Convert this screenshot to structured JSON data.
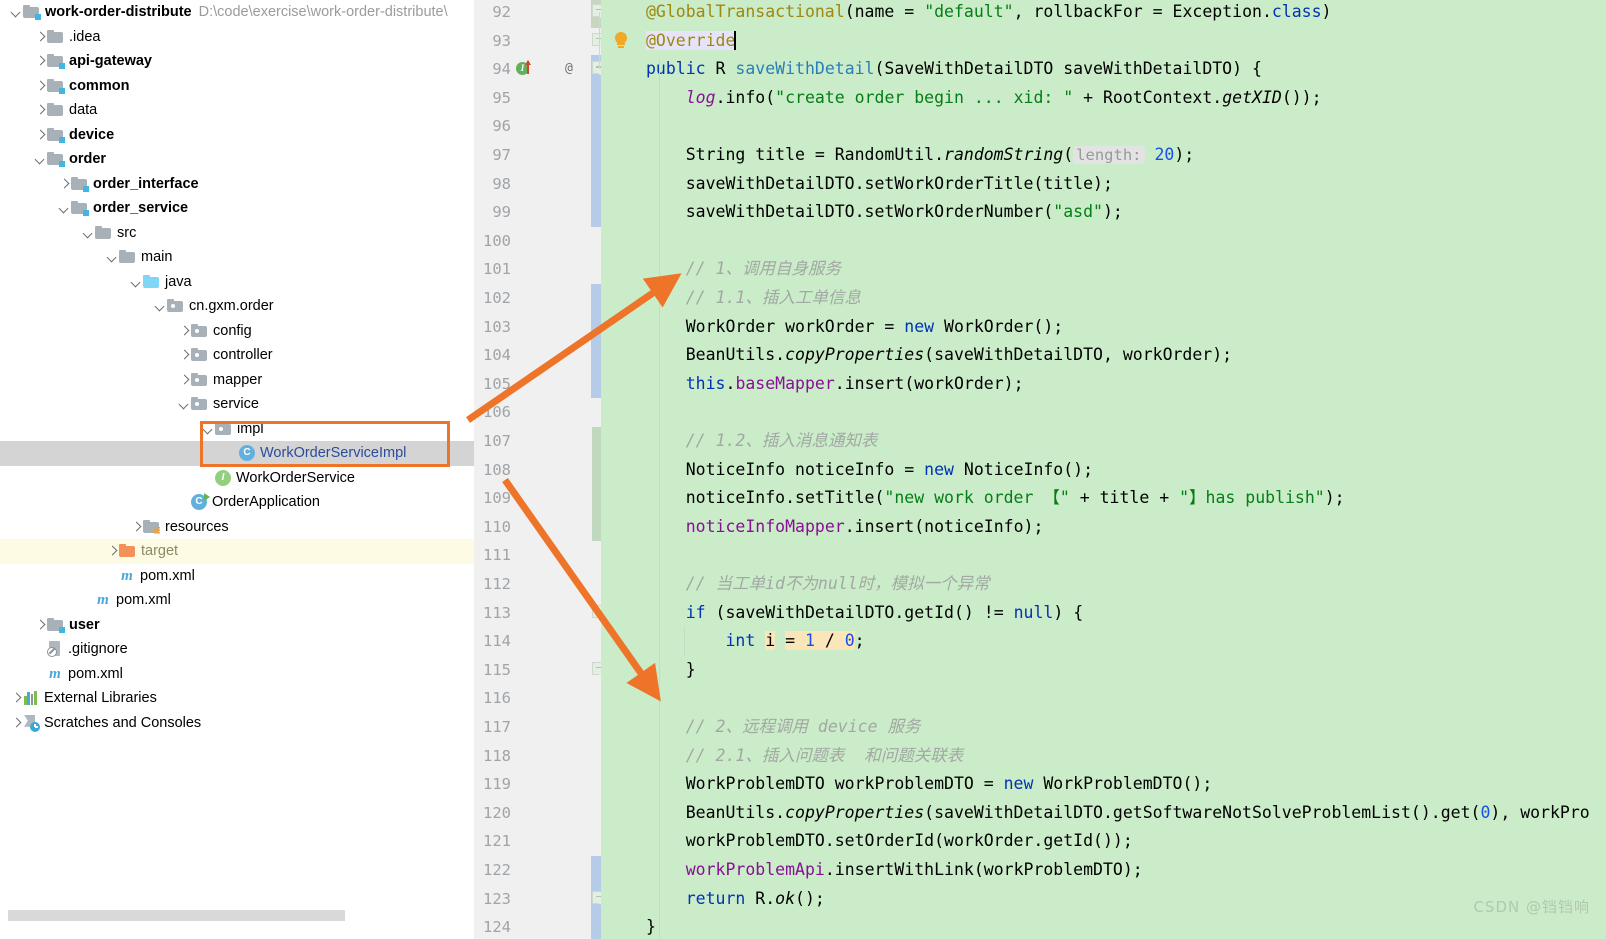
{
  "project": {
    "root": {
      "name": "work-order-distribute",
      "path": "D:\\code\\exercise\\work-order-distribute\\"
    },
    "items": [
      {
        "label": ".idea",
        "indent": 1,
        "arrow": "closed",
        "icon": "folder",
        "bold": false
      },
      {
        "label": "api-gateway",
        "indent": 1,
        "arrow": "closed",
        "icon": "module",
        "bold": true
      },
      {
        "label": "common",
        "indent": 1,
        "arrow": "closed",
        "icon": "module",
        "bold": true
      },
      {
        "label": "data",
        "indent": 1,
        "arrow": "closed",
        "icon": "folder",
        "bold": false
      },
      {
        "label": "device",
        "indent": 1,
        "arrow": "closed",
        "icon": "module",
        "bold": true
      },
      {
        "label": "order",
        "indent": 1,
        "arrow": "open",
        "icon": "module",
        "bold": true
      },
      {
        "label": "order_interface",
        "indent": 2,
        "arrow": "closed",
        "icon": "module",
        "bold": true
      },
      {
        "label": "order_service",
        "indent": 2,
        "arrow": "open",
        "icon": "module",
        "bold": true
      },
      {
        "label": "src",
        "indent": 3,
        "arrow": "open",
        "icon": "folder",
        "bold": false
      },
      {
        "label": "main",
        "indent": 4,
        "arrow": "open",
        "icon": "folder",
        "bold": false
      },
      {
        "label": "java",
        "indent": 5,
        "arrow": "open",
        "icon": "source",
        "bold": false
      },
      {
        "label": "cn.gxm.order",
        "indent": 6,
        "arrow": "open",
        "icon": "package",
        "bold": false
      },
      {
        "label": "config",
        "indent": 7,
        "arrow": "closed",
        "icon": "package",
        "bold": false
      },
      {
        "label": "controller",
        "indent": 7,
        "arrow": "closed",
        "icon": "package",
        "bold": false
      },
      {
        "label": "mapper",
        "indent": 7,
        "arrow": "closed",
        "icon": "package",
        "bold": false
      },
      {
        "label": "service",
        "indent": 7,
        "arrow": "open",
        "icon": "package",
        "bold": false
      },
      {
        "label": "impl",
        "indent": 8,
        "arrow": "open",
        "icon": "package",
        "bold": false
      },
      {
        "label": "WorkOrderServiceImpl",
        "indent": 9,
        "arrow": "none",
        "icon": "class",
        "bold": false,
        "selected": true
      },
      {
        "label": "WorkOrderService",
        "indent": 8,
        "arrow": "none",
        "icon": "interface",
        "bold": false
      },
      {
        "label": "OrderApplication",
        "indent": 7,
        "arrow": "none",
        "icon": "spring-app",
        "bold": false
      },
      {
        "label": "resources",
        "indent": 5,
        "arrow": "closed",
        "icon": "resources",
        "bold": false
      },
      {
        "label": "target",
        "indent": 4,
        "arrow": "closed",
        "icon": "excluded",
        "bold": false,
        "excluded": true
      },
      {
        "label": "pom.xml",
        "indent": 4,
        "arrow": "none",
        "icon": "maven",
        "bold": false
      },
      {
        "label": "pom.xml",
        "indent": 3,
        "arrow": "none",
        "icon": "maven",
        "bold": false
      },
      {
        "label": "user",
        "indent": 1,
        "arrow": "closed",
        "icon": "module",
        "bold": true
      },
      {
        "label": ".gitignore",
        "indent": 1,
        "arrow": "none",
        "icon": "gitignore",
        "bold": false
      },
      {
        "label": "pom.xml",
        "indent": 1,
        "arrow": "none",
        "icon": "maven",
        "bold": false
      },
      {
        "label": "External Libraries",
        "indent": 0,
        "arrow": "closed",
        "icon": "libraries",
        "bold": false
      },
      {
        "label": "Scratches and Consoles",
        "indent": 0,
        "arrow": "closed",
        "icon": "scratches",
        "bold": false
      }
    ]
  },
  "editor": {
    "first_line": 92,
    "caret_line": 93,
    "lines": [
      {
        "n": 92,
        "tokens": [
          {
            "t": "@GlobalTransactional",
            "c": "ann"
          },
          {
            "t": "(",
            "c": "plain"
          },
          {
            "t": "name",
            "c": "plain"
          },
          {
            "t": " = ",
            "c": "plain"
          },
          {
            "t": "\"default\"",
            "c": "str"
          },
          {
            "t": ", rollbackFor = Exception.",
            "c": "plain"
          },
          {
            "t": "class",
            "c": "kw"
          },
          {
            "t": ")",
            "c": "plain"
          }
        ]
      },
      {
        "n": 93,
        "tokens": [
          {
            "t": "@Override",
            "c": "ann sel"
          },
          {
            "t": "CARET",
            "c": "caret"
          }
        ]
      },
      {
        "n": 94,
        "tokens": [
          {
            "t": "public",
            "c": "kw"
          },
          {
            "t": " R ",
            "c": "plain"
          },
          {
            "t": "saveWithDetail",
            "c": "ident-blue"
          },
          {
            "t": "(SaveWithDetailDTO saveWithDetailDTO) {",
            "c": "plain"
          }
        ]
      },
      {
        "n": 95,
        "tokens": [
          {
            "t": "    ",
            "c": "plain"
          },
          {
            "t": "log",
            "c": "stat"
          },
          {
            "t": ".info(",
            "c": "plain"
          },
          {
            "t": "\"create order begin ... xid: \"",
            "c": "str"
          },
          {
            "t": " + RootContext.",
            "c": "plain"
          },
          {
            "t": "getXID",
            "c": "mthi"
          },
          {
            "t": "());",
            "c": "plain"
          }
        ]
      },
      {
        "n": 96,
        "tokens": []
      },
      {
        "n": 97,
        "tokens": [
          {
            "t": "    String title = RandomUtil.",
            "c": "plain"
          },
          {
            "t": "randomString",
            "c": "mthi"
          },
          {
            "t": "(",
            "c": "plain"
          },
          {
            "t": "HINT:length:",
            "c": "hint"
          },
          {
            "t": " ",
            "c": "plain"
          },
          {
            "t": "20",
            "c": "num"
          },
          {
            "t": ");",
            "c": "plain"
          }
        ]
      },
      {
        "n": 98,
        "tokens": [
          {
            "t": "    saveWithDetailDTO.setWorkOrderTitle(title);",
            "c": "plain"
          }
        ]
      },
      {
        "n": 99,
        "tokens": [
          {
            "t": "    saveWithDetailDTO.setWorkOrderNumber(",
            "c": "plain"
          },
          {
            "t": "\"asd\"",
            "c": "str"
          },
          {
            "t": ");",
            "c": "plain"
          }
        ]
      },
      {
        "n": 100,
        "tokens": []
      },
      {
        "n": 101,
        "tokens": [
          {
            "t": "    // 1、调用自身服务",
            "c": "cmt"
          }
        ]
      },
      {
        "n": 102,
        "tokens": [
          {
            "t": "    // 1.1、插入工单信息",
            "c": "cmt"
          }
        ]
      },
      {
        "n": 103,
        "tokens": [
          {
            "t": "    WorkOrder workOrder = ",
            "c": "plain"
          },
          {
            "t": "new",
            "c": "kw"
          },
          {
            "t": " WorkOrder();",
            "c": "plain"
          }
        ]
      },
      {
        "n": 104,
        "tokens": [
          {
            "t": "    BeanUtils.",
            "c": "plain"
          },
          {
            "t": "copyProperties",
            "c": "mthi"
          },
          {
            "t": "(saveWithDetailDTO, workOrder);",
            "c": "plain"
          }
        ]
      },
      {
        "n": 105,
        "tokens": [
          {
            "t": "    ",
            "c": "plain"
          },
          {
            "t": "this",
            "c": "kw"
          },
          {
            "t": ".",
            "c": "plain"
          },
          {
            "t": "baseMapper",
            "c": "fld"
          },
          {
            "t": ".insert(workOrder);",
            "c": "plain"
          }
        ]
      },
      {
        "n": 106,
        "tokens": []
      },
      {
        "n": 107,
        "tokens": [
          {
            "t": "    // 1.2、插入消息通知表",
            "c": "cmt"
          }
        ]
      },
      {
        "n": 108,
        "tokens": [
          {
            "t": "    NoticeInfo noticeInfo = ",
            "c": "plain"
          },
          {
            "t": "new",
            "c": "kw"
          },
          {
            "t": " NoticeInfo();",
            "c": "plain"
          }
        ]
      },
      {
        "n": 109,
        "tokens": [
          {
            "t": "    noticeInfo.setTitle(",
            "c": "plain"
          },
          {
            "t": "\"new work order 【\"",
            "c": "str"
          },
          {
            "t": " + title + ",
            "c": "plain"
          },
          {
            "t": "\"】has publish\"",
            "c": "str"
          },
          {
            "t": ");",
            "c": "plain"
          }
        ]
      },
      {
        "n": 110,
        "tokens": [
          {
            "t": "    ",
            "c": "plain"
          },
          {
            "t": "noticeInfoMapper",
            "c": "fld"
          },
          {
            "t": ".insert(noticeInfo);",
            "c": "plain"
          }
        ]
      },
      {
        "n": 111,
        "tokens": []
      },
      {
        "n": 112,
        "tokens": [
          {
            "t": "    // 当工单id不为null时，模拟一个异常",
            "c": "cmt"
          }
        ]
      },
      {
        "n": 113,
        "tokens": [
          {
            "t": "    ",
            "c": "plain"
          },
          {
            "t": "if",
            "c": "kw"
          },
          {
            "t": " (saveWithDetailDTO.getId() != ",
            "c": "plain"
          },
          {
            "t": "null",
            "c": "kw"
          },
          {
            "t": ") {",
            "c": "plain"
          }
        ]
      },
      {
        "n": 114,
        "tokens": [
          {
            "t": "        ",
            "c": "plain"
          },
          {
            "t": "int",
            "c": "kw"
          },
          {
            "t": " ",
            "c": "plain"
          },
          {
            "t": "i",
            "c": "plain warnhl"
          },
          {
            "t": " ",
            "c": "plain"
          },
          {
            "t": "= ",
            "c": "plain warnhl"
          },
          {
            "t": "1",
            "c": "num warnhl"
          },
          {
            "t": " / ",
            "c": "plain warnhl"
          },
          {
            "t": "0",
            "c": "num warnhl"
          },
          {
            "t": ";",
            "c": "plain"
          }
        ]
      },
      {
        "n": 115,
        "tokens": [
          {
            "t": "    }",
            "c": "plain"
          }
        ]
      },
      {
        "n": 116,
        "tokens": []
      },
      {
        "n": 117,
        "tokens": [
          {
            "t": "    // 2、远程调用 device 服务",
            "c": "cmt"
          }
        ]
      },
      {
        "n": 118,
        "tokens": [
          {
            "t": "    // 2.1、插入问题表  和问题关联表",
            "c": "cmt"
          }
        ]
      },
      {
        "n": 119,
        "tokens": [
          {
            "t": "    WorkProblemDTO workProblemDTO = ",
            "c": "plain"
          },
          {
            "t": "new",
            "c": "kw"
          },
          {
            "t": " WorkProblemDTO();",
            "c": "plain"
          }
        ]
      },
      {
        "n": 120,
        "tokens": [
          {
            "t": "    BeanUtils.",
            "c": "plain"
          },
          {
            "t": "copyProperties",
            "c": "mthi"
          },
          {
            "t": "(saveWithDetailDTO.getSoftwareNotSolveProblemList().get(",
            "c": "plain"
          },
          {
            "t": "0",
            "c": "num"
          },
          {
            "t": "), workPro",
            "c": "plain"
          }
        ]
      },
      {
        "n": 121,
        "tokens": [
          {
            "t": "    workProblemDTO.setOrderId(workOrder.getId());",
            "c": "plain"
          }
        ]
      },
      {
        "n": 122,
        "tokens": [
          {
            "t": "    ",
            "c": "plain"
          },
          {
            "t": "workProblemApi",
            "c": "fld"
          },
          {
            "t": ".insertWithLink(workProblemDTO);",
            "c": "plain"
          }
        ]
      },
      {
        "n": 123,
        "tokens": [
          {
            "t": "    ",
            "c": "plain"
          },
          {
            "t": "return",
            "c": "kw"
          },
          {
            "t": " R.",
            "c": "plain"
          },
          {
            "t": "ok",
            "c": "mthi"
          },
          {
            "t": "();",
            "c": "plain"
          }
        ]
      },
      {
        "n": 124,
        "tokens": [
          {
            "t": "}",
            "c": "plain"
          }
        ]
      }
    ],
    "gutter_markers": [
      {
        "line": 94,
        "kind": "override-marker"
      },
      {
        "line": 94,
        "kind": "at-symbol",
        "glyph": "@"
      },
      {
        "line": 93,
        "kind": "intention-bulb"
      }
    ]
  },
  "annotations": {
    "highlight_rect_target": "WorkOrderServiceImpl",
    "arrows": [
      {
        "from": "WorkOrderServiceImpl-row",
        "to": "line-101-comment"
      },
      {
        "from": "WorkOrderServiceImpl-row",
        "to": "line-117-comment"
      }
    ],
    "accent_color": "#ee7429"
  },
  "watermark": {
    "text": "CSDN @铛铛响"
  }
}
